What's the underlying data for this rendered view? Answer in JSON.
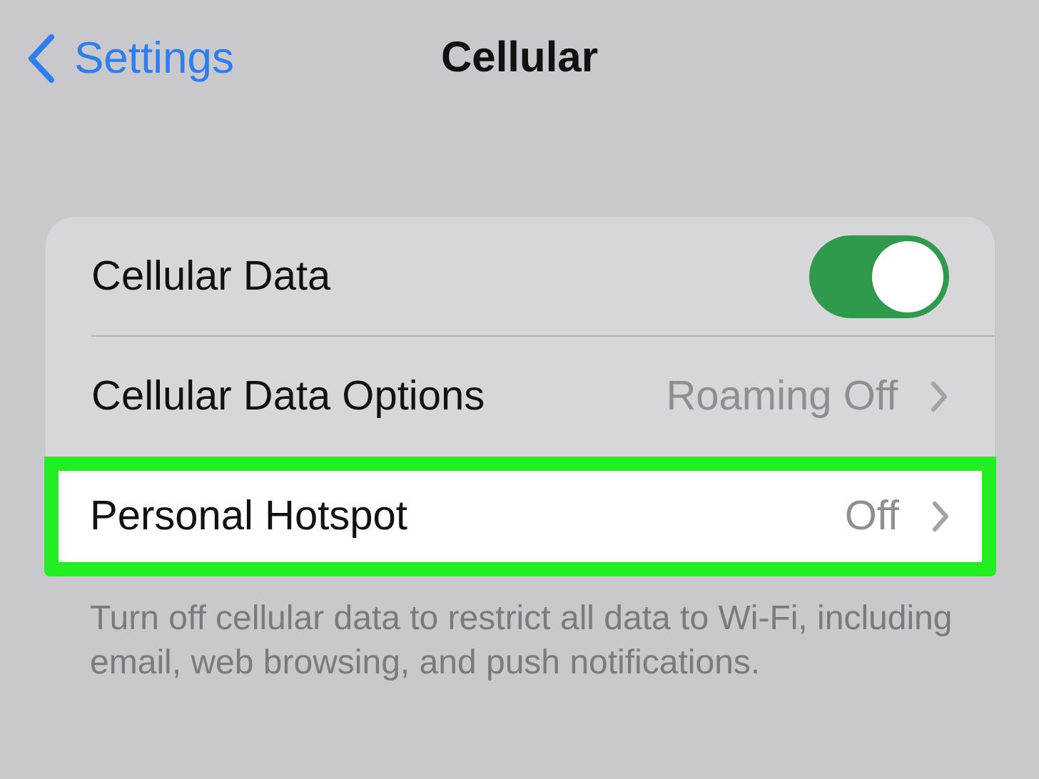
{
  "nav": {
    "back_label": "Settings",
    "title": "Cellular"
  },
  "rows": [
    {
      "kind": "toggle",
      "label": "Cellular Data",
      "on": true,
      "highlighted": false
    },
    {
      "kind": "link",
      "label": "Cellular Data Options",
      "value": "Roaming Off",
      "highlighted": false
    },
    {
      "kind": "link",
      "label": "Personal Hotspot",
      "value": "Off",
      "highlighted": true
    }
  ],
  "footer": "Turn off cellular data to restrict all data to Wi-Fi, including email, web browsing, and push notifications."
}
